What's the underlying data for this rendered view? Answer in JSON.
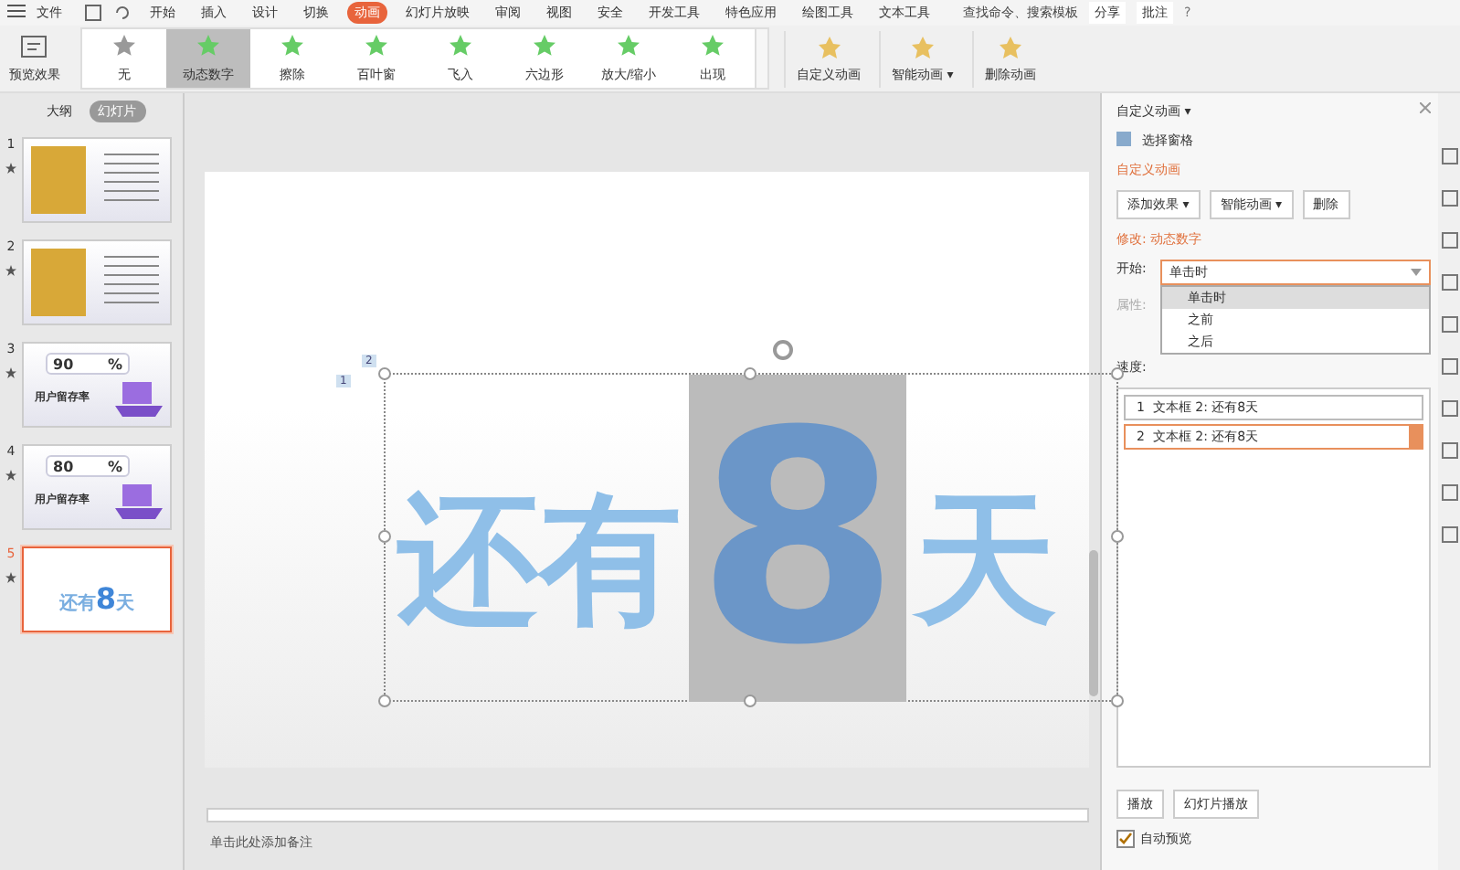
{
  "menu": {
    "file": "文件",
    "tabs": [
      {
        "label": "开始",
        "selected": false
      },
      {
        "label": "插入",
        "selected": false
      },
      {
        "label": "设计",
        "selected": false
      },
      {
        "label": "切换",
        "selected": false
      },
      {
        "label": "动画",
        "selected": true
      },
      {
        "label": "幻灯片放映",
        "selected": false
      },
      {
        "label": "审阅",
        "selected": false
      },
      {
        "label": "视图",
        "selected": false
      },
      {
        "label": "安全",
        "selected": false
      },
      {
        "label": "开发工具",
        "selected": false
      },
      {
        "label": "特色应用",
        "selected": false
      },
      {
        "label": "绘图工具",
        "selected": false
      },
      {
        "label": "文本工具",
        "selected": false
      }
    ],
    "search_placeholder": "查找命令、搜索模板",
    "share": "分享",
    "comment": "批注",
    "help": "?"
  },
  "ribbon": {
    "preview": "预览效果",
    "effects": [
      {
        "label": "无",
        "selected": false
      },
      {
        "label": "动态数字",
        "selected": true
      },
      {
        "label": "擦除",
        "selected": false
      },
      {
        "label": "百叶窗",
        "selected": false
      },
      {
        "label": "飞入",
        "selected": false
      },
      {
        "label": "六边形",
        "selected": false
      },
      {
        "label": "放大/缩小",
        "selected": false
      },
      {
        "label": "出现",
        "selected": false
      }
    ],
    "actions": [
      "自定义动画",
      "智能动画 ▾",
      "删除动画"
    ]
  },
  "thumbnails": {
    "tabs": [
      {
        "label": "大纲",
        "selected": false
      },
      {
        "label": "幻灯片",
        "selected": true
      }
    ],
    "slides": [
      {
        "number": "1",
        "selected": false,
        "kind": "photo"
      },
      {
        "number": "2",
        "selected": false,
        "kind": "photo"
      },
      {
        "number": "3",
        "selected": false,
        "kind": "percent",
        "value": "90",
        "unit": "%",
        "caption": "用户留存率"
      },
      {
        "number": "4",
        "selected": false,
        "kind": "percent",
        "value": "80",
        "unit": "%",
        "caption": "用户留存率"
      },
      {
        "number": "5",
        "selected": true,
        "kind": "countdown",
        "before": "还有",
        "digit": "8",
        "after": "天"
      }
    ]
  },
  "slide": {
    "tags": [
      "1",
      "2"
    ],
    "before": "还有",
    "digit": "8",
    "after": "天"
  },
  "notes_placeholder": "单击此处添加备注",
  "panel": {
    "title": "自定义动画 ▾",
    "selection_pane": "选择窗格",
    "section": "自定义动画",
    "buttons": [
      "添加效果 ▾",
      "智能动画 ▾",
      "删除"
    ],
    "modify": "修改: 动态数字",
    "start_label": "开始:",
    "start_value": "单击时",
    "options": [
      {
        "label": "单击时",
        "selected": true
      },
      {
        "label": "之前",
        "selected": false
      },
      {
        "label": "之后",
        "selected": false
      }
    ],
    "property_label": "属性:",
    "speed_label": "速度:",
    "items": [
      {
        "number": "1",
        "label": "文本框 2: 还有8天",
        "selected": false
      },
      {
        "number": "2",
        "label": "文本框 2: 还有8天",
        "selected": true
      }
    ],
    "play": "播放",
    "slideshow": "幻灯片播放",
    "auto_preview": {
      "label": "自动预览",
      "checked": true
    }
  }
}
